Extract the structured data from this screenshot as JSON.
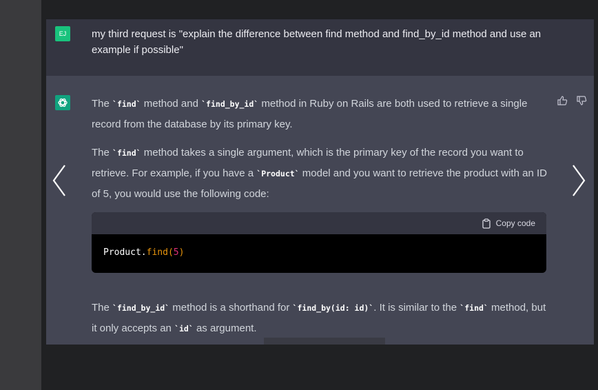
{
  "user_message": {
    "initials": "EJ",
    "text": "my third request is \"explain the difference between find method and find_by_id method and use an example if possible\""
  },
  "assistant": {
    "p1": {
      "a": "The ",
      "c1": "`find`",
      "b": " method and ",
      "c2": "`find_by_id`",
      "d": " method in Ruby on Rails are both used to retrieve a single record from the database by its primary key."
    },
    "p2": {
      "a": "The ",
      "c1": "`find`",
      "b": " method takes a single argument, which is the primary key of the record you want to retrieve. For example, if you have a ",
      "c2": "`Product`",
      "d": " model and you want to retrieve the product with an ID of 5, you would use the following code:"
    },
    "code": {
      "copy_label": "Copy code",
      "obj": "Product.",
      "method": "find",
      "open": "(",
      "arg": "5",
      "close": ")"
    },
    "p3": {
      "a": "The ",
      "c1": "`find_by_id`",
      "b": " method is a shorthand for ",
      "c2": "`find_by(id: id)`",
      "d": ". It is similar to the ",
      "c3": "`find`",
      "e": " method, but it only accepts an ",
      "c4": "`id`",
      "f": " as argument."
    }
  },
  "icons": {
    "thumbs_up": "thumbs-up-icon",
    "thumbs_down": "thumbs-down-icon",
    "prev": "chevron-left-icon",
    "next": "chevron-right-icon",
    "clipboard": "clipboard-icon",
    "openai": "openai-logo-icon"
  },
  "colors": {
    "accent_green": "#19c37d",
    "gpt_green": "#10a37f",
    "code_method": "#e9950c",
    "code_number": "#df3079"
  }
}
